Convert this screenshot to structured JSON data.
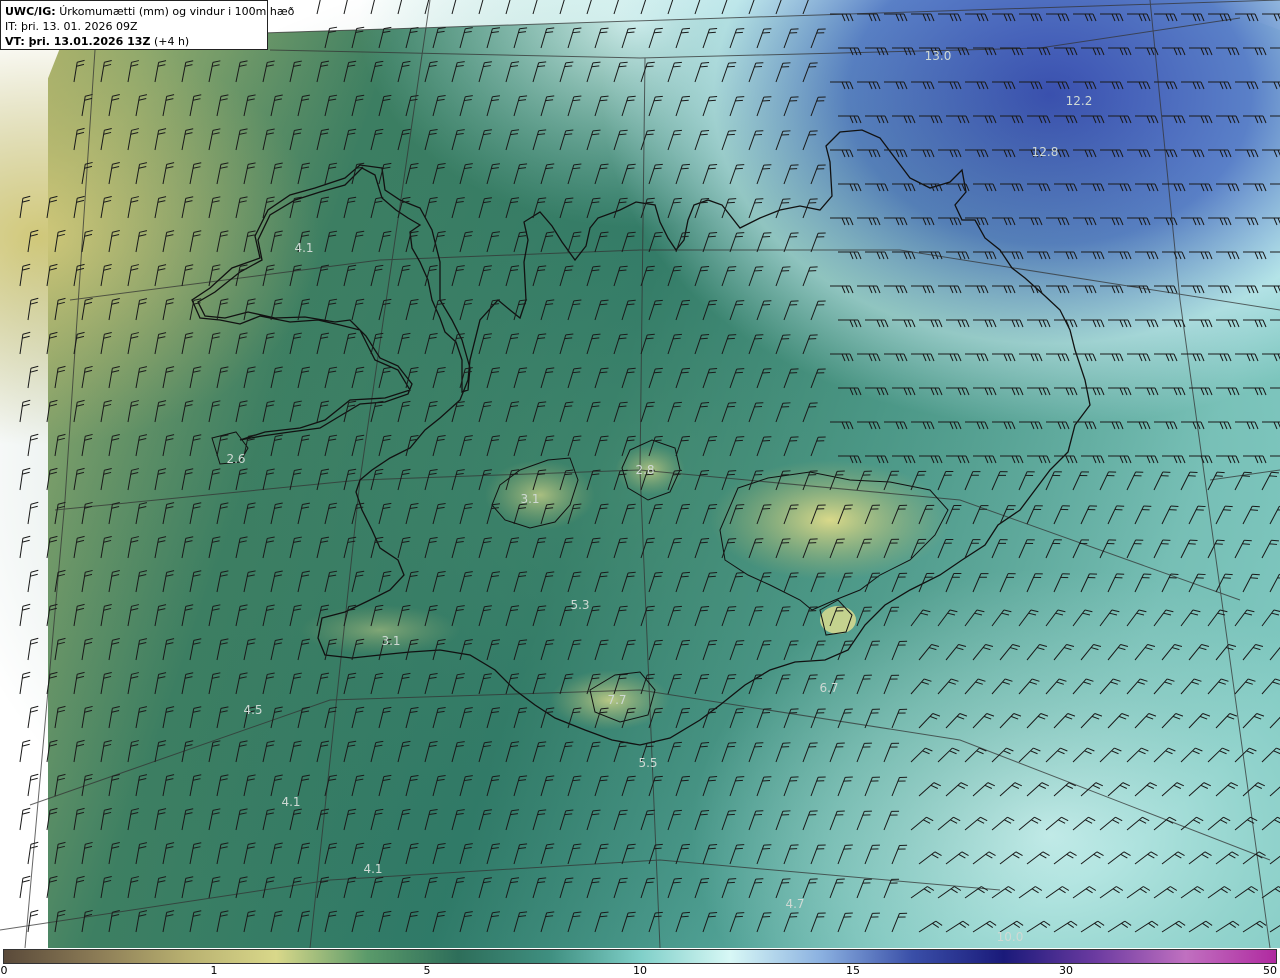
{
  "header": {
    "product_label": "UWC/IG:",
    "title": "Úrkomumætti (mm) og vindur i 100m hæð",
    "it_line": "IT: þri. 13. 01. 2026 09Z",
    "vt_label": "VT: þri. 13.01.2026 13Z",
    "vt_suffix": "(+4 h)"
  },
  "value_labels": [
    {
      "text": "13.0"
    },
    {
      "text": "12.2"
    },
    {
      "text": "12.8"
    },
    {
      "text": "4.1"
    },
    {
      "text": "2.6"
    },
    {
      "text": "2.8"
    },
    {
      "text": "3.1"
    },
    {
      "text": "5.3"
    },
    {
      "text": "3.1"
    },
    {
      "text": "7.7"
    },
    {
      "text": "6.7"
    },
    {
      "text": "4.5"
    },
    {
      "text": "5.5"
    },
    {
      "text": "4.1"
    },
    {
      "text": "4.1"
    },
    {
      "text": "4.7"
    },
    {
      "text": "10.0"
    }
  ],
  "colorbar": {
    "ticks": [
      "0",
      "1",
      "5",
      "10",
      "15",
      "30",
      "50"
    ],
    "colors": [
      "#5a4a3a",
      "#8a7a55",
      "#b8b070",
      "#d9d88a",
      "#5a9a6a",
      "#2e6e5a",
      "#3f8f80",
      "#7fcfc8",
      "#d8f8f6",
      "#8ab0e0",
      "#3a4fa8",
      "#1a1a7a",
      "#6a3aa0",
      "#c070c0",
      "#b02aa0"
    ]
  },
  "colors": {
    "coastline": "#111111",
    "barb": "#1a1a1a",
    "grid": "#333333",
    "label": "#cfd9d4"
  }
}
